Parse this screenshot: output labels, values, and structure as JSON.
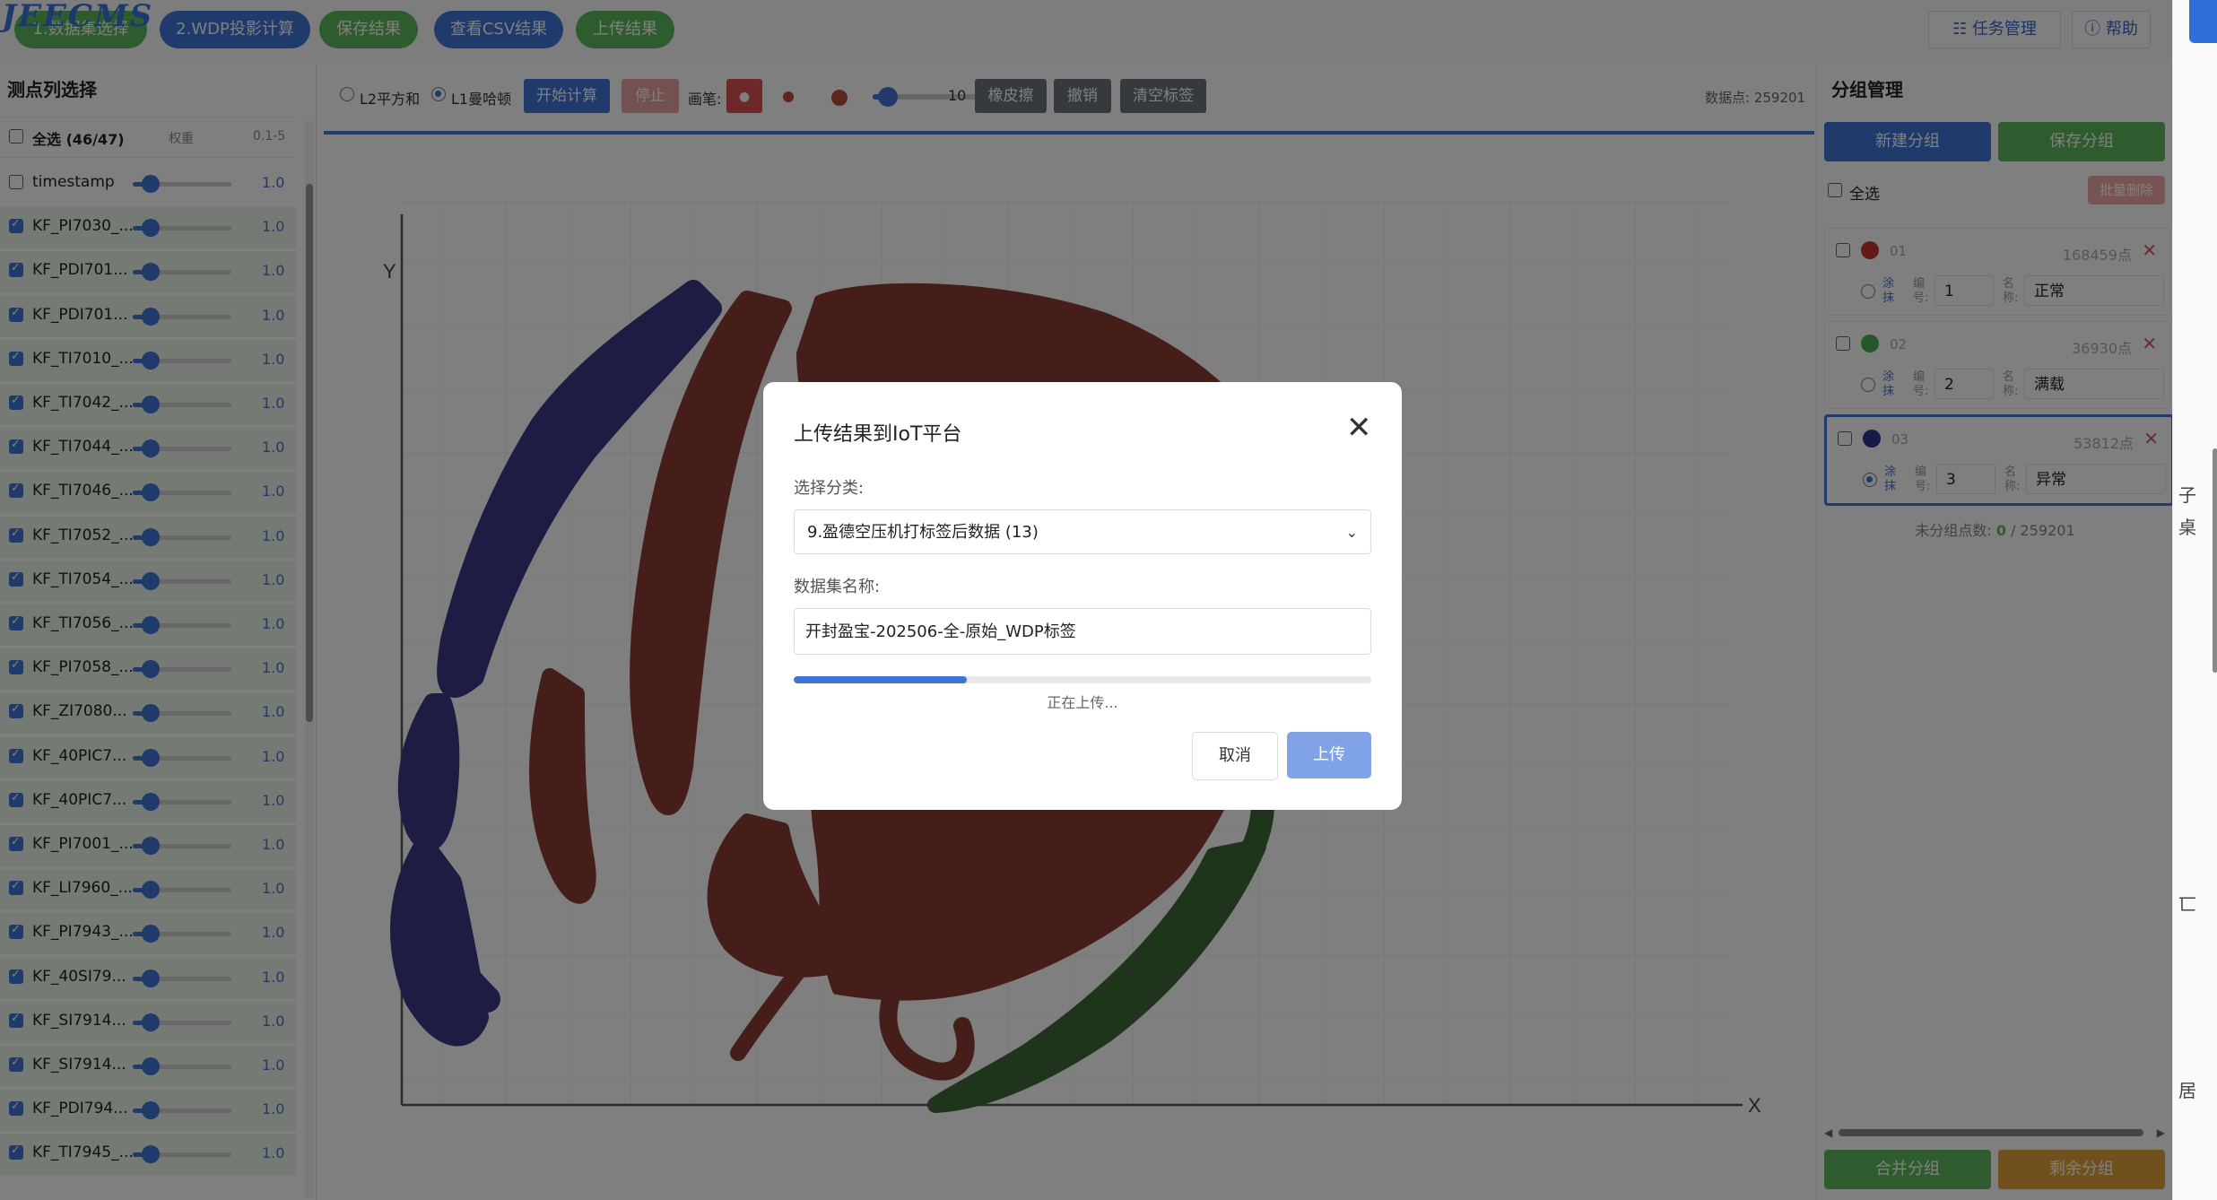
{
  "logo": "JEECMS",
  "top_tabs": [
    "1.数据集选择",
    "2.WDP投影计算",
    "保存结果",
    "查看CSV结果",
    "上传结果"
  ],
  "top_right": {
    "tasks": "☷ 任务管理",
    "help": "ⓘ 帮助"
  },
  "left": {
    "title": "测点列选择",
    "select_all": "全选 (46/47)",
    "weight_label": "权重",
    "range_label": "0.1-5",
    "rows": [
      {
        "name": "timestamp",
        "checked": false,
        "value": "1.0"
      },
      {
        "name": "KF_PI7030_...",
        "checked": true,
        "value": "1.0"
      },
      {
        "name": "KF_PDI701...",
        "checked": true,
        "value": "1.0"
      },
      {
        "name": "KF_PDI701...",
        "checked": true,
        "value": "1.0"
      },
      {
        "name": "KF_TI7010_...",
        "checked": true,
        "value": "1.0"
      },
      {
        "name": "KF_TI7042_...",
        "checked": true,
        "value": "1.0"
      },
      {
        "name": "KF_TI7044_...",
        "checked": true,
        "value": "1.0"
      },
      {
        "name": "KF_TI7046_...",
        "checked": true,
        "value": "1.0"
      },
      {
        "name": "KF_TI7052_...",
        "checked": true,
        "value": "1.0"
      },
      {
        "name": "KF_TI7054_...",
        "checked": true,
        "value": "1.0"
      },
      {
        "name": "KF_TI7056_...",
        "checked": true,
        "value": "1.0"
      },
      {
        "name": "KF_PI7058_...",
        "checked": true,
        "value": "1.0"
      },
      {
        "name": "KF_ZI7080...",
        "checked": true,
        "value": "1.0"
      },
      {
        "name": "KF_40PIC7...",
        "checked": true,
        "value": "1.0"
      },
      {
        "name": "KF_40PIC7...",
        "checked": true,
        "value": "1.0"
      },
      {
        "name": "KF_PI7001_...",
        "checked": true,
        "value": "1.0"
      },
      {
        "name": "KF_LI7960_...",
        "checked": true,
        "value": "1.0"
      },
      {
        "name": "KF_PI7943_...",
        "checked": true,
        "value": "1.0"
      },
      {
        "name": "KF_40SI79...",
        "checked": true,
        "value": "1.0"
      },
      {
        "name": "KF_SI7914...",
        "checked": true,
        "value": "1.0"
      },
      {
        "name": "KF_SI7914...",
        "checked": true,
        "value": "1.0"
      },
      {
        "name": "KF_PDI794...",
        "checked": true,
        "value": "1.0"
      },
      {
        "name": "KF_TI7945_...",
        "checked": true,
        "value": "1.0"
      }
    ]
  },
  "toolbar": {
    "l2": "L2平方和",
    "l1": "L1曼哈顿",
    "start": "开始计算",
    "stop": "停止",
    "brush": "画笔:",
    "brush_size": "10",
    "eraser": "橡皮擦",
    "undo": "撤销",
    "clear": "清空标签",
    "data_points": "数据点: 259201"
  },
  "plot": {
    "x_label": "X",
    "y_label": "Y"
  },
  "colors": {
    "blue": "#3a3a86",
    "red": "#8a3a33",
    "green": "#3f6b36",
    "accent": "#3f74d6"
  },
  "right": {
    "title": "分组管理",
    "new_group": "新建分组",
    "save_group": "保存分组",
    "select_all": "全选",
    "batch_delete": "批量删除",
    "paint_label": "涂抹",
    "num_label": "编号:",
    "name_label": "名称:",
    "groups": [
      {
        "id": "01",
        "count": "168459点",
        "num": "1",
        "name": "正常",
        "color": "#c0392b"
      },
      {
        "id": "02",
        "count": "36930点",
        "num": "2",
        "name": "满载",
        "color": "#4caf50"
      },
      {
        "id": "03",
        "count": "53812点",
        "num": "3",
        "name": "异常",
        "color": "#2c3592"
      }
    ],
    "unassigned_prefix": "未分组点数:",
    "unassigned_count": "0",
    "unassigned_total": "/ 259201",
    "merge": "合并分组",
    "remaining": "剩余分组"
  },
  "modal": {
    "title": "上传结果到IoT平台",
    "category_label": "选择分类:",
    "category_value": "9.盈德空压机打标签后数据 (13)",
    "dataset_label": "数据集名称:",
    "dataset_value": "开封盈宝-202506-全-原始_WDP标签",
    "progress": 0.3,
    "status": "正在上传...",
    "cancel": "取消",
    "upload": "上传"
  },
  "side_chars": [
    "子",
    "桌",
    "匸",
    "居"
  ]
}
